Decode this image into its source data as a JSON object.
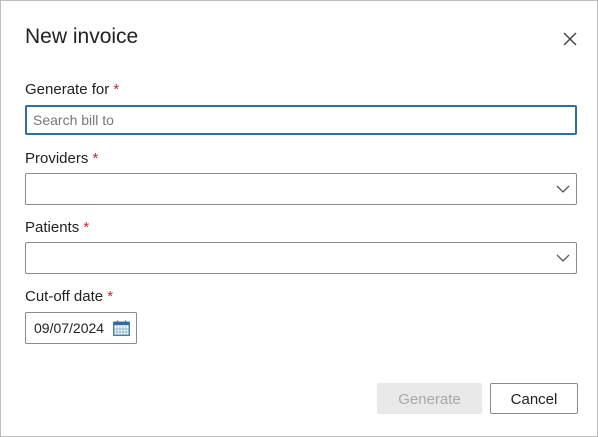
{
  "dialog": {
    "title": "New invoice",
    "close_icon": "close-icon"
  },
  "fields": {
    "generate_for": {
      "label": "Generate for",
      "required_mark": "*",
      "placeholder": "Search bill to",
      "value": ""
    },
    "providers": {
      "label": "Providers",
      "required_mark": "*",
      "value": "",
      "icon": "chevron-down-icon"
    },
    "patients": {
      "label": "Patients",
      "required_mark": "*",
      "value": "",
      "icon": "chevron-down-icon"
    },
    "cutoff_date": {
      "label": "Cut-off date",
      "required_mark": "*",
      "value": "09/07/2024",
      "icon": "calendar-icon"
    }
  },
  "buttons": {
    "generate_label": "Generate",
    "generate_disabled": true,
    "cancel_label": "Cancel"
  },
  "colors": {
    "required": "#c62828",
    "focus_border": "#2f6f9f",
    "disabled_bg": "#e9e9e9",
    "disabled_text": "#a8a8a8"
  }
}
